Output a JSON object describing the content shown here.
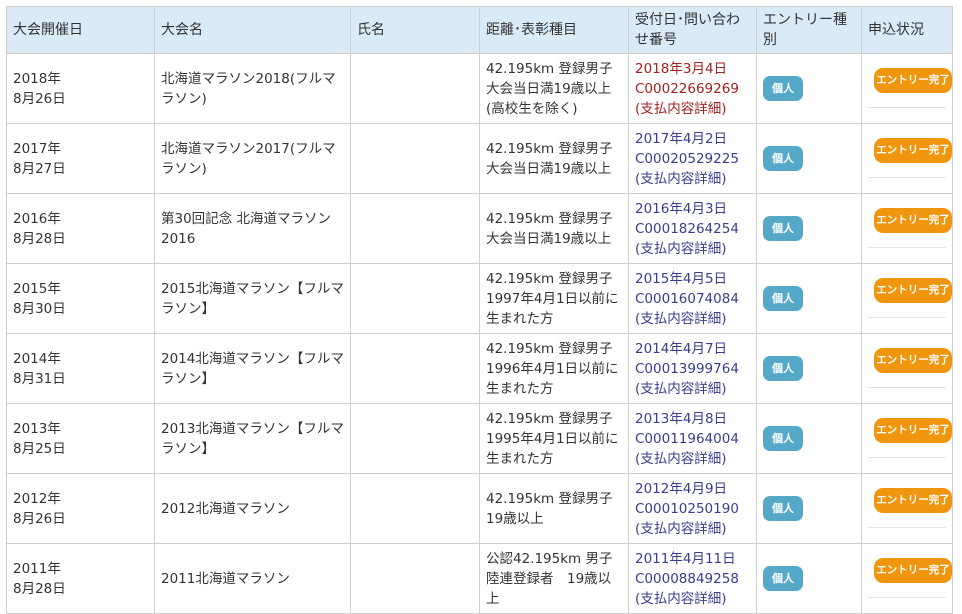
{
  "table": {
    "headers": {
      "date": "大会開催日",
      "event": "大会名",
      "name": "氏名",
      "category": "距離･表彰種目",
      "receipt": "受付日･問い合わせ番号",
      "entry_type": "エントリー種別",
      "status": "申込状況"
    },
    "rows": [
      {
        "date_year": "2018年",
        "date_day": "8月26日",
        "event": "北海道マラソン2018(フルマラソン)",
        "name": "",
        "category": "42.195km 登録男子 大会当日満19歳以上(高校生を除く)",
        "receipt_date": "2018年3月4日",
        "receipt_number": "C00022669269",
        "payment_link": "(支払内容詳細)",
        "entry_type": "個人",
        "status": "エントリー完了"
      },
      {
        "date_year": "2017年",
        "date_day": "8月27日",
        "event": "北海道マラソン2017(フルマラソン)",
        "name": "",
        "category": "42.195km 登録男子 大会当日満19歳以上",
        "receipt_date": "2017年4月2日",
        "receipt_number": "C00020529225",
        "payment_link": "(支払内容詳細)",
        "entry_type": "個人",
        "status": "エントリー完了"
      },
      {
        "date_year": "2016年",
        "date_day": "8月28日",
        "event": "第30回記念 北海道マラソン2016",
        "name": "",
        "category": "42.195km 登録男子 大会当日満19歳以上",
        "receipt_date": "2016年4月3日",
        "receipt_number": "C00018264254",
        "payment_link": "(支払内容詳細)",
        "entry_type": "個人",
        "status": "エントリー完了"
      },
      {
        "date_year": "2015年",
        "date_day": "8月30日",
        "event": "2015北海道マラソン【フルマラソン】",
        "name": "",
        "category": "42.195km 登録男子 1997年4月1日以前に生まれた方",
        "receipt_date": "2015年4月5日",
        "receipt_number": "C00016074084",
        "payment_link": "(支払内容詳細)",
        "entry_type": "個人",
        "status": "エントリー完了"
      },
      {
        "date_year": "2014年",
        "date_day": "8月31日",
        "event": "2014北海道マラソン【フルマラソン】",
        "name": "",
        "category": "42.195km 登録男子 1996年4月1日以前に生まれた方",
        "receipt_date": "2014年4月7日",
        "receipt_number": "C00013999764",
        "payment_link": "(支払内容詳細)",
        "entry_type": "個人",
        "status": "エントリー完了"
      },
      {
        "date_year": "2013年",
        "date_day": "8月25日",
        "event": "2013北海道マラソン【フルマラソン】",
        "name": "",
        "category": "42.195km 登録男子 1995年4月1日以前に生まれた方",
        "receipt_date": "2013年4月8日",
        "receipt_number": "C00011964004",
        "payment_link": "(支払内容詳細)",
        "entry_type": "個人",
        "status": "エントリー完了"
      },
      {
        "date_year": "2012年",
        "date_day": "8月26日",
        "event": "2012北海道マラソン",
        "name": "",
        "category": "42.195km 登録男子 19歳以上",
        "receipt_date": "2012年4月9日",
        "receipt_number": "C00010250190",
        "payment_link": "(支払内容詳細)",
        "entry_type": "個人",
        "status": "エントリー完了"
      },
      {
        "date_year": "2011年",
        "date_day": "8月28日",
        "event": "2011北海道マラソン",
        "name": "",
        "category": "公認42.195km 男子陸連登録者　19歳以上",
        "receipt_date": "2011年4月11日",
        "receipt_number": "C00008849258",
        "payment_link": "(支払内容詳細)",
        "entry_type": "個人",
        "status": "エントリー完了"
      }
    ]
  },
  "colors": {
    "header_bg": "#daeaf7",
    "latest_receipt": "#a52020",
    "receipt_link": "#3a3d8f",
    "badge_individual": "#56a8c9",
    "badge_done": "#f0960e"
  }
}
